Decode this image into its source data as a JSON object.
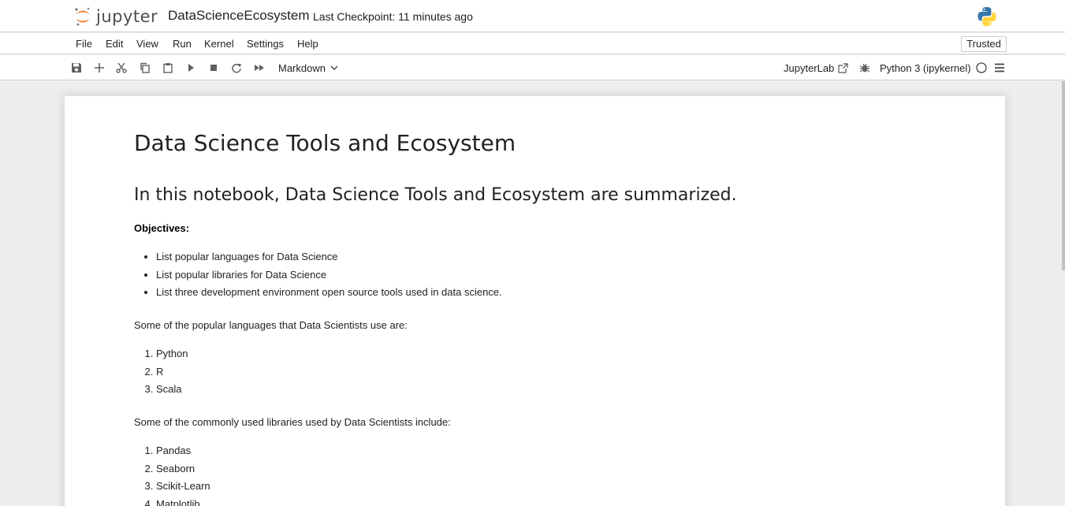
{
  "header": {
    "logo_text": "jupyter",
    "notebook_title": "DataScienceEcosystem",
    "checkpoint": "Last Checkpoint: 11 minutes ago"
  },
  "menu": {
    "items": [
      "File",
      "Edit",
      "View",
      "Run",
      "Kernel",
      "Settings",
      "Help"
    ],
    "trusted": "Trusted"
  },
  "toolbar": {
    "cell_type": "Markdown",
    "jupyterlab_link": "JupyterLab",
    "kernel": "Python 3 (ipykernel)",
    "icons": [
      "save-icon",
      "add-icon",
      "cut-icon",
      "copy-icon",
      "paste-icon",
      "run-icon",
      "stop-icon",
      "restart-icon",
      "fast-forward-icon"
    ]
  },
  "notebook": {
    "h1": "Data Science Tools and Ecosystem",
    "h2": "In this notebook, Data Science Tools and Ecosystem are summarized.",
    "objectives_label": "Objectives:",
    "objectives": [
      "List popular languages for Data Science",
      "List popular libraries for Data Science",
      "List three development environment open source tools used in data science."
    ],
    "languages_intro": "Some of the popular languages that Data Scientists use are:",
    "languages": [
      "Python",
      "R",
      "Scala"
    ],
    "libraries_intro": "Some of the commonly used libraries used by Data Scientists include:",
    "libraries": [
      "Pandas",
      "Seaborn",
      "Scikit-Learn",
      "Matplotlib"
    ]
  },
  "colors": {
    "jupyter_orange": "#f37726",
    "python_blue": "#3776ab",
    "python_yellow": "#ffd43b"
  }
}
